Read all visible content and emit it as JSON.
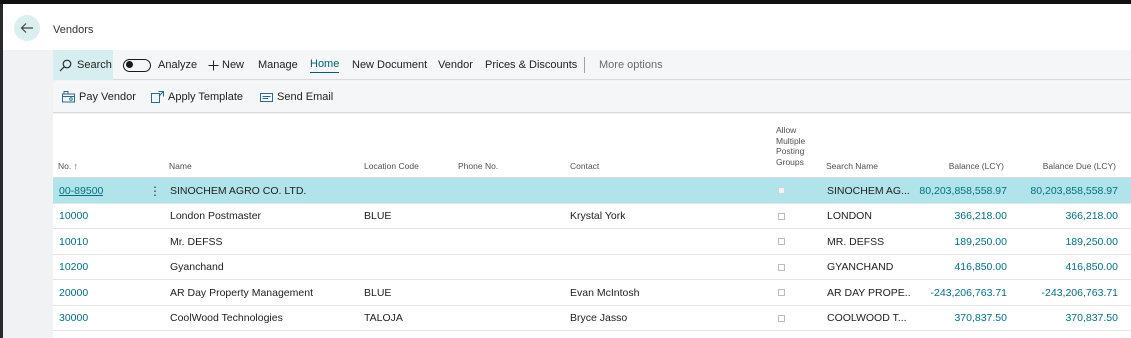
{
  "page": {
    "title": "Vendors"
  },
  "actionbar": {
    "search": "Search",
    "analyze": "Analyze",
    "new": "New",
    "manage": "Manage",
    "home": "Home",
    "new_document": "New Document",
    "vendor": "Vendor",
    "prices_discounts": "Prices & Discounts",
    "more_options": "More options"
  },
  "subbar": {
    "pay_vendor": "Pay Vendor",
    "apply_template": "Apply Template",
    "send_email": "Send Email"
  },
  "table": {
    "columns": {
      "no": "No. ↑",
      "name": "Name",
      "location_code": "Location Code",
      "phone_no": "Phone No.",
      "contact": "Contact",
      "allow_multiple_1": "Allow",
      "allow_multiple_2": "Multiple",
      "allow_multiple_3": "Posting",
      "allow_multiple_4": "Groups",
      "search_name": "Search Name",
      "balance": "Balance (LCY)",
      "balance_due": "Balance Due (LCY)"
    },
    "rows": [
      {
        "no": "00-89500",
        "name": "SINOCHEM AGRO CO. LTD.",
        "location": "",
        "phone": "",
        "contact": "",
        "allow_multiple": false,
        "search_name": "SINOCHEM AG...",
        "balance": "80,203,858,558.97",
        "balance_due": "80,203,858,558.97"
      },
      {
        "no": "10000",
        "name": "London Postmaster",
        "location": "BLUE",
        "phone": "",
        "contact": "Krystal York",
        "allow_multiple": false,
        "search_name": "LONDON",
        "balance": "366,218.00",
        "balance_due": "366,218.00"
      },
      {
        "no": "10010",
        "name": "Mr. DEFSS",
        "location": "",
        "phone": "",
        "contact": "",
        "allow_multiple": false,
        "search_name": "MR. DEFSS",
        "balance": "189,250.00",
        "balance_due": "189,250.00"
      },
      {
        "no": "10200",
        "name": "Gyanchand",
        "location": "",
        "phone": "",
        "contact": "",
        "allow_multiple": false,
        "search_name": "GYANCHAND",
        "balance": "416,850.00",
        "balance_due": "416,850.00"
      },
      {
        "no": "20000",
        "name": "AR Day Property Management",
        "location": "BLUE",
        "phone": "",
        "contact": "Evan McIntosh",
        "allow_multiple": false,
        "search_name": "AR DAY PROPE...",
        "balance": "-243,206,763.71",
        "balance_due": "-243,206,763.71"
      },
      {
        "no": "30000",
        "name": "CoolWood Technologies",
        "location": "TALOJA",
        "phone": "",
        "contact": "Bryce Jasso",
        "allow_multiple": false,
        "search_name": "COOLWOOD T...",
        "balance": "370,837.50",
        "balance_due": "370,837.50"
      }
    ]
  },
  "colors": {
    "accent": "#00707d",
    "selected_row": "#b1e4ea",
    "search_bg": "#d7eef1"
  }
}
